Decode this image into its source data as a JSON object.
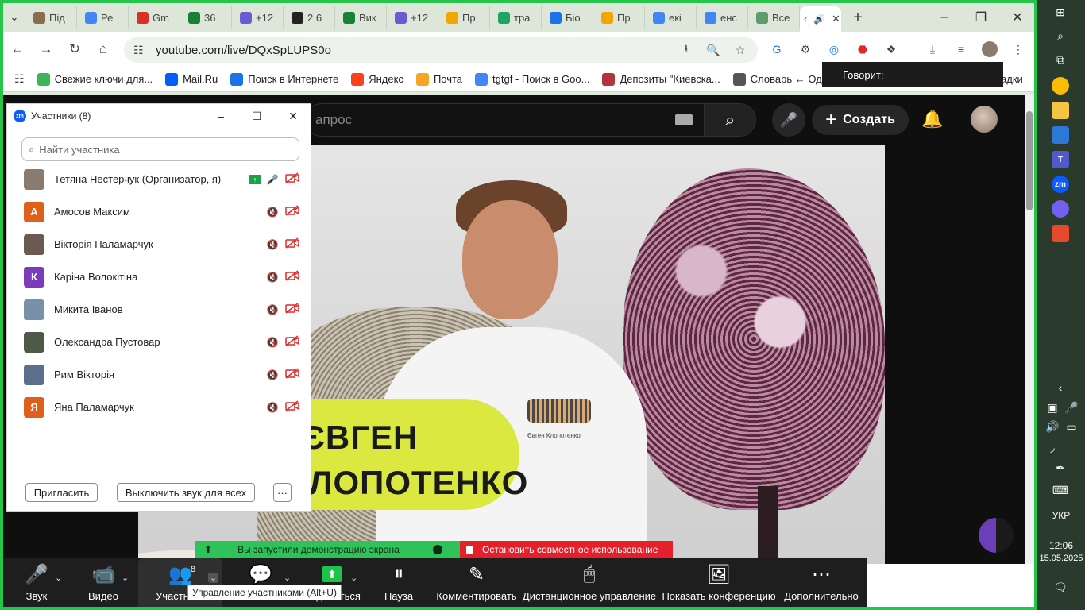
{
  "browser": {
    "tabs": [
      {
        "label": "Під",
        "icon": "book-icon",
        "color": "#8a6d4b"
      },
      {
        "label": "Ре",
        "icon": "docs-icon",
        "color": "#4285f4"
      },
      {
        "label": "Gm",
        "icon": "gmail-icon",
        "color": "#d93025"
      },
      {
        "label": "36 ",
        "icon": "sheets-icon",
        "color": "#188038"
      },
      {
        "label": "+12",
        "icon": "forms-icon",
        "color": "#6b5bd2"
      },
      {
        "label": "2 6",
        "icon": "openai-icon",
        "color": "#222222"
      },
      {
        "label": "Вик",
        "icon": "sheets-icon",
        "color": "#188038"
      },
      {
        "label": "+12",
        "icon": "forms-icon",
        "color": "#6b5bd2"
      },
      {
        "label": "Пр",
        "icon": "bell-icon",
        "color": "#f2a600"
      },
      {
        "label": "тра",
        "icon": "drive-icon",
        "color": "#1fa463"
      },
      {
        "label": "Біо",
        "icon": "contacts-icon",
        "color": "#1a73e8"
      },
      {
        "label": "Пр",
        "icon": "bell-icon",
        "color": "#f2a600"
      },
      {
        "label": "екі",
        "icon": "google-icon",
        "color": "#4285f4"
      },
      {
        "label": "енс",
        "icon": "google-icon",
        "color": "#4285f4"
      },
      {
        "label": "Все",
        "icon": "site-icon",
        "color": "#5b9c6a"
      }
    ],
    "active_tab": {
      "label": "‹"
    },
    "new_tab": "+",
    "url": "youtube.com/live/DQxSpLUPS0o",
    "bookmarks": [
      {
        "label": "Свежие ключи для...",
        "color": "#3bb55a"
      },
      {
        "label": "Mail.Ru",
        "color": "#005ff9"
      },
      {
        "label": "Поиск в Интернете",
        "color": "#1a73e8"
      },
      {
        "label": "Яндекс",
        "color": "#fc3f1d"
      },
      {
        "label": "Почта",
        "color": "#f5a623"
      },
      {
        "label": "tgtgf - Поиск в Goo...",
        "color": "#4285f4"
      },
      {
        "label": "Депозиты \"Киевска...",
        "color": "#b2353c"
      },
      {
        "label": "Словарь ← Одесса...",
        "color": "#555555"
      }
    ],
    "bookmarks_overflow": "адки",
    "speaking_tooltip": "Говорит:"
  },
  "youtube": {
    "search_placeholder": "апрос",
    "create_label": "Создать",
    "video": {
      "banner_line1": "ЄВГЕН",
      "banner_line2": "ЛОПОТЕНКО",
      "logo_caption": "Євген Клопотенко"
    }
  },
  "zoom_panel": {
    "title": "Участники (8)",
    "search_placeholder": "Найти участника",
    "participants": [
      {
        "name": "Тетяна Нестерчук (Организатор, я)",
        "initial": "",
        "avatar_color": "#8a7b70",
        "sharing": true,
        "mic": "on",
        "video": "off"
      },
      {
        "name": "Амосов Максим",
        "initial": "А",
        "avatar_color": "#e0601b",
        "sharing": false,
        "mic": "off",
        "video": "off"
      },
      {
        "name": "Вікторія Паламарчук",
        "initial": "",
        "avatar_color": "#6b5a52",
        "sharing": false,
        "mic": "off",
        "video": "off"
      },
      {
        "name": "Каріна Волокітіна",
        "initial": "К",
        "avatar_color": "#7c3bb8",
        "sharing": false,
        "mic": "off",
        "video": "off"
      },
      {
        "name": "Микита Іванов",
        "initial": "",
        "avatar_color": "#7890a8",
        "sharing": false,
        "mic": "off",
        "video": "off"
      },
      {
        "name": "Олександра Пустовар",
        "initial": "",
        "avatar_color": "#4d5a48",
        "sharing": false,
        "mic": "off",
        "video": "off"
      },
      {
        "name": "Рим Вікторія",
        "initial": "",
        "avatar_color": "#5b6f8c",
        "sharing": false,
        "mic": "off",
        "video": "off"
      },
      {
        "name": "Яна Паламарчук",
        "initial": "Я",
        "avatar_color": "#e0601b",
        "sharing": false,
        "mic": "off",
        "video": "off"
      }
    ],
    "invite_label": "Пригласить",
    "mute_all_label": "Выключить звук для всех",
    "more_label": "···"
  },
  "zoom_share": {
    "sharing_text": "Вы запустили демонстрацию экрана",
    "stop_text": "Остановить совместное использование"
  },
  "zoom_toolbar": {
    "items": [
      {
        "label": "Звук",
        "icon": "microphone-icon"
      },
      {
        "label": "Видео",
        "icon": "video-off-icon"
      },
      {
        "label": "Участники",
        "icon": "participants-icon"
      },
      {
        "label": "Чат",
        "icon": "chat-icon"
      },
      {
        "label": "Поделиться",
        "icon": "share-screen-icon"
      },
      {
        "label": "Пауза",
        "icon": "pause-icon"
      },
      {
        "label": "Комментировать",
        "icon": "pencil-icon"
      },
      {
        "label": "Дистанционное управление",
        "icon": "mouse-icon"
      },
      {
        "label": "Показать конференцию",
        "icon": "show-meeting-icon"
      },
      {
        "label": "Дополнительно",
        "icon": "more-icon"
      }
    ],
    "participants_count": "8",
    "tooltip": "Управление участниками (Alt+U)"
  },
  "system": {
    "language": "УКР",
    "time": "12:06",
    "date": "15.05.2025"
  },
  "colors": {
    "share_green": "#26c44a",
    "stop_red": "#e6202a",
    "zoom_blue": "#0b5cff",
    "muted_red": "#e02828"
  }
}
